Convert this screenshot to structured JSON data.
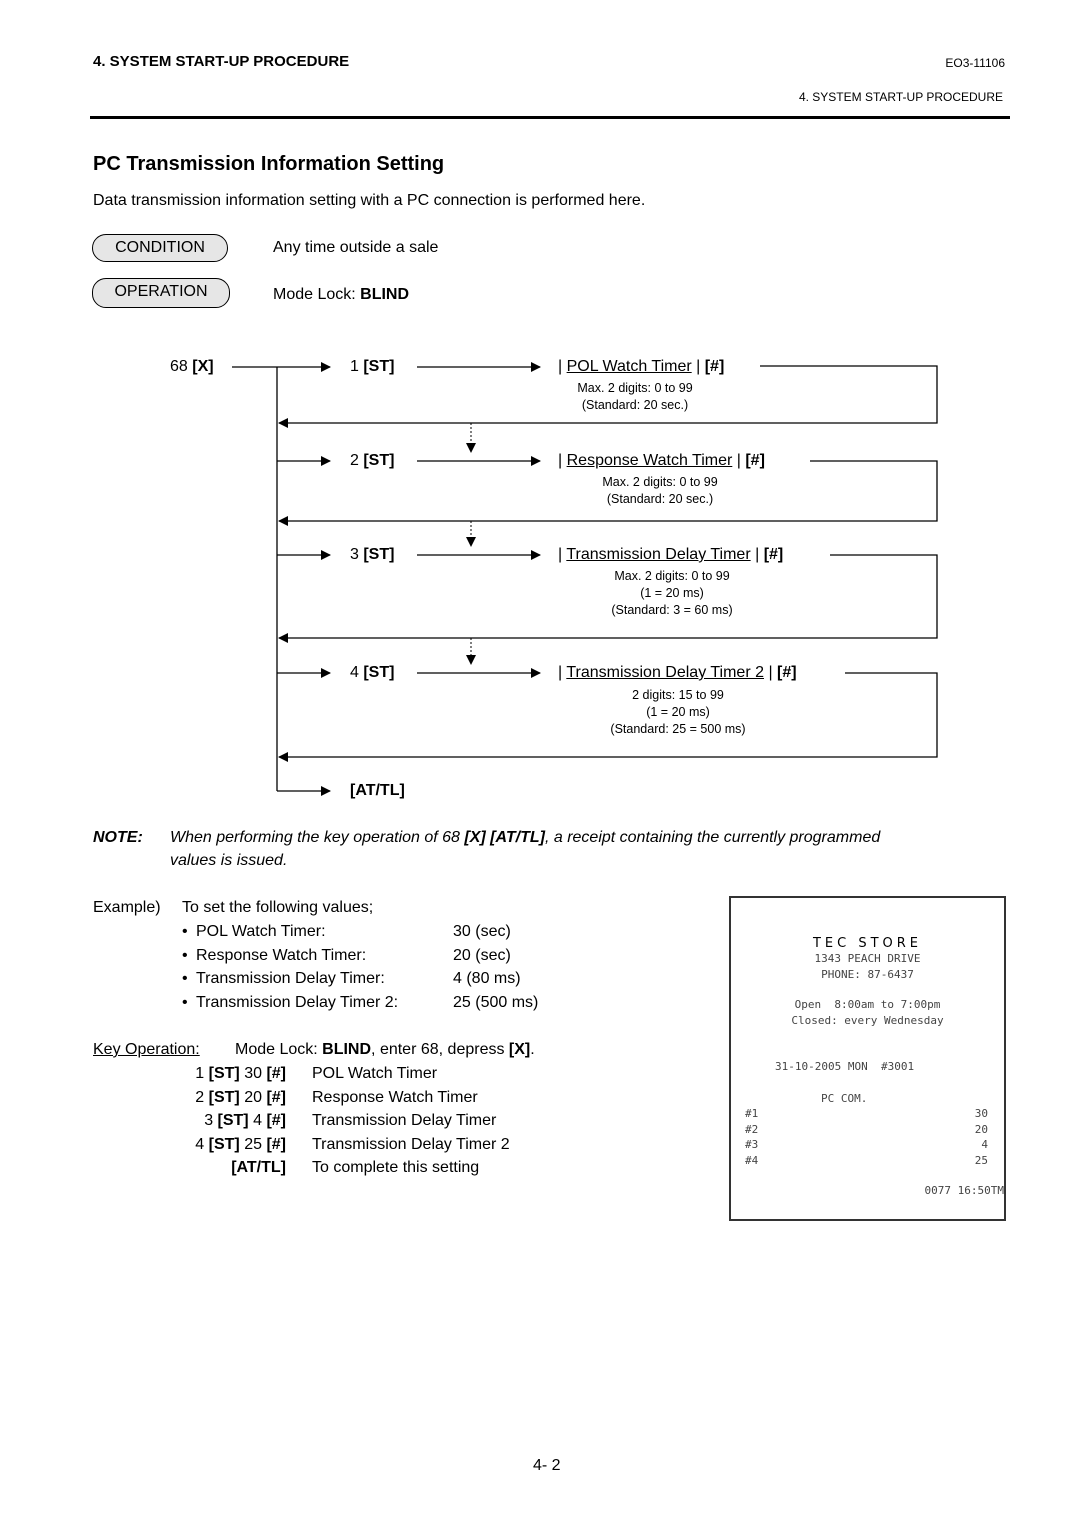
{
  "header": {
    "section": "4. SYSTEM START-UP PROCEDURE",
    "doc_id": "EO3-11106",
    "running_title": "4. SYSTEM START-UP PROCEDURE"
  },
  "title": "PC Transmission Information Setting",
  "intro": "Data transmission information setting with a PC connection is performed here.",
  "condition": {
    "label": "CONDITION",
    "text": "Any time outside a sale"
  },
  "operation": {
    "label": "OPERATION",
    "text_prefix": "Mode Lock: ",
    "text_bold": "BLIND"
  },
  "flow": {
    "start": {
      "num": "68 ",
      "key": "[X]"
    },
    "steps": [
      {
        "num": "1 ",
        "key": "[ST]",
        "name": "POL Watch Timer",
        "enter": "[#]",
        "notes": [
          "Max. 2 digits: 0 to 99",
          "(Standard: 20 sec.)"
        ]
      },
      {
        "num": "2 ",
        "key": "[ST]",
        "name": "Response Watch Timer",
        "enter": "[#]",
        "notes": [
          "Max. 2 digits: 0 to 99",
          "(Standard: 20 sec.)"
        ]
      },
      {
        "num": "3 ",
        "key": "[ST]",
        "name": "Transmission Delay Timer",
        "enter": "[#]",
        "notes": [
          "Max. 2 digits: 0 to 99",
          "(1 = 20 ms)",
          "(Standard: 3 = 60 ms)"
        ]
      },
      {
        "num": "4 ",
        "key": "[ST]",
        "name": "Transmission Delay Timer 2",
        "enter": "[#]",
        "notes": [
          "2 digits: 15 to 99",
          "(1 = 20 ms)",
          "(Standard: 25 = 500 ms)"
        ]
      }
    ],
    "end": "[AT/TL]"
  },
  "note": {
    "label": "NOTE:",
    "line1_a": "When performing the key operation of 68 ",
    "line1_b": "[X] [AT/TL]",
    "line1_c": ", a receipt containing the currently programmed",
    "line2": "values is issued."
  },
  "example": {
    "label": "Example)",
    "intro": "To set the following values;",
    "bullet": "•",
    "items": [
      {
        "name": "POL Watch Timer:",
        "value": "30 (sec)"
      },
      {
        "name": "Response Watch Timer:",
        "value": "20 (sec)"
      },
      {
        "name": "Transmission Delay Timer:",
        "value": "4 (80 ms)"
      },
      {
        "name": "Transmission Delay Timer 2:",
        "value": "25 (500 ms)"
      }
    ]
  },
  "key_operation": {
    "label": "Key Operation:",
    "t1": "Mode Lock: ",
    "t2": "BLIND",
    "t3": ", enter 68, depress ",
    "t4": "[X]",
    "t5": ".",
    "rows": [
      {
        "keys": [
          [
            "1 ",
            ""
          ],
          [
            "[ST]",
            "b"
          ],
          [
            " 30 ",
            ""
          ],
          [
            "[#]",
            "b"
          ]
        ],
        "desc": "POL Watch Timer"
      },
      {
        "keys": [
          [
            "2 ",
            ""
          ],
          [
            "[ST]",
            "b"
          ],
          [
            " 20 ",
            ""
          ],
          [
            "[#]",
            "b"
          ]
        ],
        "desc": "Response Watch Timer"
      },
      {
        "keys": [
          [
            "3 ",
            ""
          ],
          [
            "[ST]",
            "b"
          ],
          [
            " 4 ",
            ""
          ],
          [
            "[#]",
            "b"
          ]
        ],
        "desc": "Transmission Delay Timer"
      },
      {
        "keys": [
          [
            "4 ",
            ""
          ],
          [
            "[ST]",
            "b"
          ],
          [
            " 25 ",
            ""
          ],
          [
            "[#]",
            "b"
          ]
        ],
        "desc": "Transmission Delay Timer 2"
      },
      {
        "keys": [
          [
            "[AT/TL]",
            "b"
          ]
        ],
        "desc": "To complete this setting"
      }
    ]
  },
  "receipt": {
    "store": "TEC STORE",
    "address": "1343 PEACH DRIVE",
    "phone": "PHONE: 87-6437",
    "hours": "Open  8:00am to 7:00pm",
    "closed": "Closed: every Wednesday",
    "date": "31-10-2005 MON  #3001",
    "title": "PC COM.",
    "lines": [
      {
        "k": "#1",
        "v": "30"
      },
      {
        "k": "#2",
        "v": "20"
      },
      {
        "k": "#3",
        "v": "4"
      },
      {
        "k": "#4",
        "v": "25"
      }
    ],
    "footer": "0077 16:50TM"
  },
  "page_number": "4- 2"
}
